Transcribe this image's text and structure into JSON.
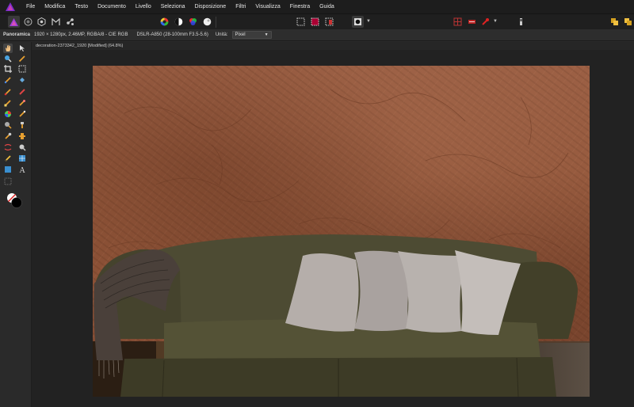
{
  "menubar": {
    "items": [
      "File",
      "Modifica",
      "Testo",
      "Documento",
      "Livello",
      "Seleziona",
      "Disposizione",
      "Filtri",
      "Visualizza",
      "Finestra",
      "Guida"
    ]
  },
  "toolbar": {
    "icons": [
      "persona-photo-icon",
      "persona-liquify-icon",
      "persona-develop-icon",
      "persona-tone-mapping-icon",
      "persona-export-icon",
      "color-wheel-icon",
      "contrast-icon",
      "channels-icon",
      "white-balance-icon",
      "marquee-rect-icon",
      "marquee-transform-icon",
      "marquee-invert-icon",
      "quick-mask-icon",
      "snapping-icon",
      "assistant-icon",
      "mask-toggle-icon",
      "arrange-icon",
      "view-mode-icon"
    ]
  },
  "context": {
    "tool_name": "Panoramica",
    "image_info": "1920 × 1280px, 2.46MP, RGBA/8 - CIE RGB",
    "camera": "DSLR-A850 (28-100mm F3.5-5.6)",
    "units_label": "Unità:",
    "units_value": "Pixel"
  },
  "document": {
    "tab_title": "decoration-2373342_1920 [Modified] (64.8%)"
  },
  "tools": [
    "hand-icon",
    "move-icon",
    "zoom-icon",
    "color-picker-icon",
    "crop-icon",
    "rect-marquee-icon",
    "selection-brush-icon",
    "flood-select-icon",
    "paint-brush-icon",
    "erase-brush-icon",
    "dodge-brush-icon",
    "smudge-brush-icon",
    "color-replace-icon",
    "inpainting-icon",
    "blur-brush-icon",
    "clone-brush-icon",
    "red-eye-icon",
    "patch-icon",
    "mesh-warp-icon",
    "perspective-icon",
    "pen-icon",
    "node-icon",
    "rect-shape-icon",
    "text-icon",
    "vector-crop-icon",
    "color-swatch-icon"
  ],
  "colors": {
    "accent": "#c8309a",
    "swatch_primary": "#000000",
    "swatch_secondary": "#ffffff"
  }
}
